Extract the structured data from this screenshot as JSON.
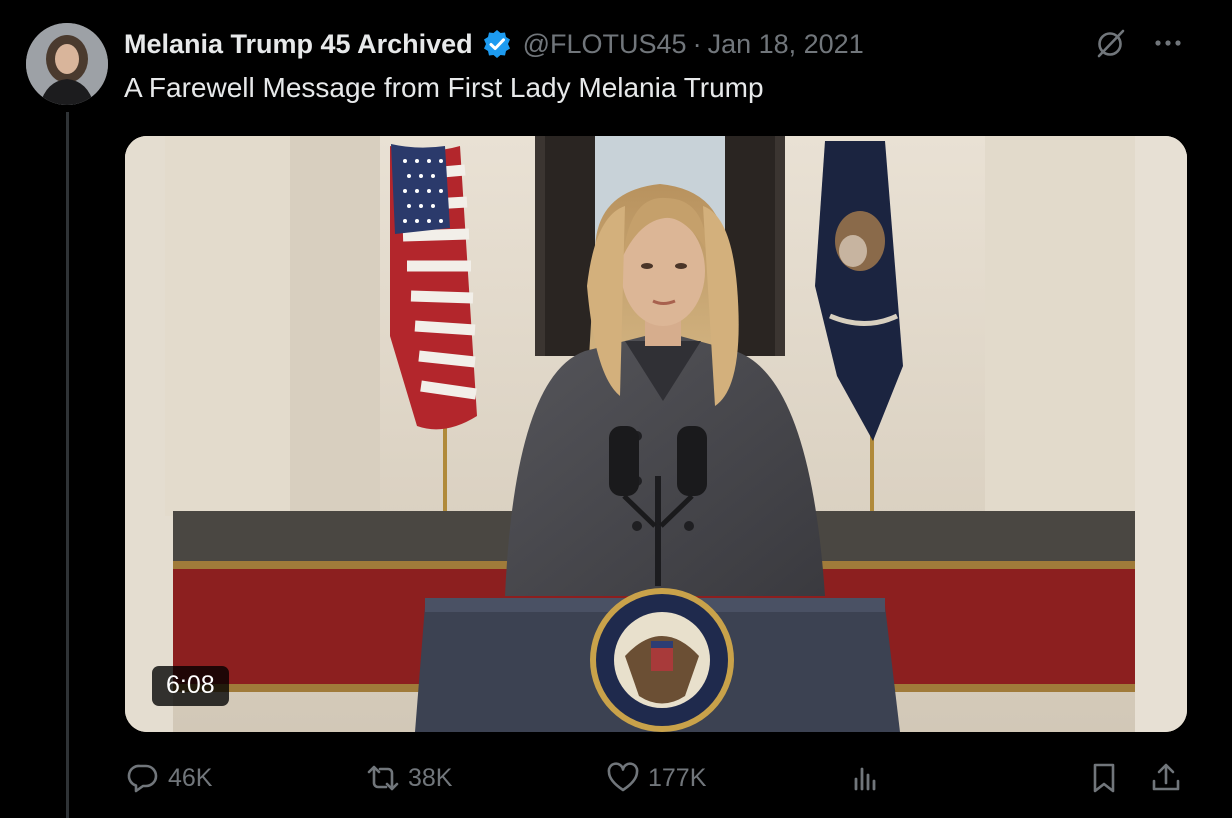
{
  "tweet": {
    "author_name": "Melania Trump 45 Archived",
    "handle": "@FLOTUS45",
    "separator": "·",
    "date": "Jan 18, 2021",
    "text": "A Farewell Message from First Lady Melania Trump",
    "avatar_icon": "profile-photo",
    "verified_icon": "verified-badge-icon",
    "verified_color": "#1d9bf0"
  },
  "media": {
    "type": "video",
    "duration": "6:08"
  },
  "actions": {
    "replies": "46K",
    "reposts": "38K",
    "likes": "177K",
    "views_icon": "analytics-icon",
    "bookmark_icon": "bookmark-icon",
    "share_icon": "share-icon"
  },
  "colors": {
    "background": "#000000",
    "text_primary": "#e7e9ea",
    "text_secondary": "#71767b",
    "divider": "#2f3336"
  }
}
